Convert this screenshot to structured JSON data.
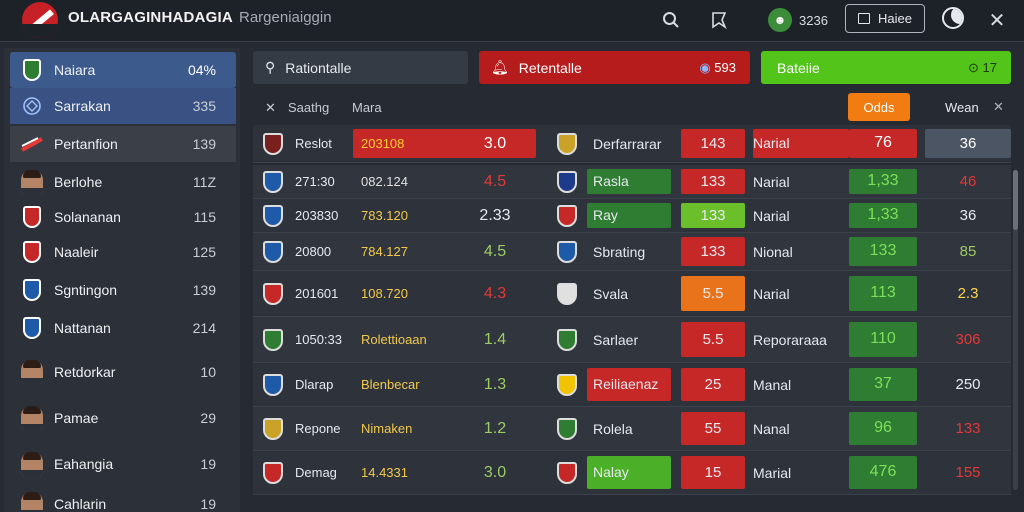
{
  "header": {
    "app_title": "OLARGAGINHADAGIA",
    "subtitle": "Rargeniaiggin",
    "user_count": "3236",
    "home_label": "Haiee"
  },
  "sidebar": {
    "items": [
      {
        "label": "Naiara",
        "value": "04%",
        "icon": "team-crest-icon",
        "color": "#2e7d32"
      },
      {
        "label": "Sarrakan",
        "value": "335",
        "icon": "globe-icon",
        "color": "#3f6fb5"
      },
      {
        "label": "Pertanfion",
        "value": "139",
        "icon": "flag-icon",
        "color": "#c62828"
      },
      {
        "label": "Berlohe",
        "value": "11Z",
        "icon": "player-avatar-icon",
        "color": "#b48466"
      },
      {
        "label": "Solananan",
        "value": "115",
        "icon": "team-crest-icon",
        "color": "#c62828"
      },
      {
        "label": "Naaleir",
        "value": "125",
        "icon": "team-crest-icon",
        "color": "#c62828"
      },
      {
        "label": "Sgntingon",
        "value": "139",
        "icon": "team-crest-icon",
        "color": "#1e5aa8"
      },
      {
        "label": "Nattanan",
        "value": "214",
        "icon": "team-crest-icon",
        "color": "#1e5aa8"
      },
      {
        "label": "Retdorkar",
        "value": "10",
        "icon": "player-avatar-icon",
        "color": "#b48466"
      },
      {
        "label": "Pamae",
        "value": "29",
        "icon": "player-avatar-icon",
        "color": "#b48466"
      },
      {
        "label": "Eahangia",
        "value": "19",
        "icon": "player-avatar-icon",
        "color": "#b48466"
      },
      {
        "label": "Cahlarin",
        "value": "19",
        "icon": "player-avatar-icon",
        "color": "#b48466"
      }
    ]
  },
  "filters": {
    "search": {
      "label": "Rationtalle"
    },
    "alert": {
      "label": "Retentalle",
      "value": "593",
      "color": "#b71c1c"
    },
    "green": {
      "label": "Bateiie",
      "value": "17",
      "color": "#52c41a"
    }
  },
  "subheader": {
    "col1": "Saathg",
    "col2": "Mara",
    "odds": "Odds",
    "wean": "Wean"
  },
  "rows": [
    {
      "time": "Reslot",
      "odds1": "203108",
      "val1": "3.0",
      "team2": "Derfarrarar",
      "s1": "143",
      "mkt": "Narial",
      "s2": "76",
      "s3": "36",
      "c_odds1": "#c62828",
      "c_val1": "#c62828",
      "c_s1": "#c62828",
      "c_mkt": "#c62828",
      "c_s2": "#c62828",
      "c_s3": "#4b5563",
      "header": true
    },
    {
      "time": "271:30",
      "odds1": "082.124",
      "val1": "4.5",
      "team2": "Rasla",
      "s1": "133",
      "mkt": "Narial",
      "s2": "1,33",
      "s3": "46",
      "c_team2": "#2e7d32",
      "c_s1": "#c62828",
      "c_s2": "#2e7d32",
      "t_val1": "#e53935",
      "t_s3": "#e53935",
      "t_odds1": "#e0e0e0"
    },
    {
      "time": "203830",
      "odds1": "783.120",
      "val1": "2.33",
      "team2": "Ray",
      "s1": "133",
      "mkt": "Narial",
      "s2": "1,33",
      "s3": "36",
      "c_team2": "#2e7d32",
      "c_s1": "#6abf2b",
      "c_s2": "#2e7d32"
    },
    {
      "time": "20800",
      "odds1": "784.127",
      "val1": "4.5",
      "team2": "Sbrating",
      "s1": "133",
      "mkt": "Nional",
      "s2": "133",
      "s3": "85",
      "c_s1": "#c62828",
      "c_s2": "#2e7d32",
      "t_val1": "#9ccc65",
      "t_s3": "#9ccc65"
    },
    {
      "time": "201601",
      "odds1": "108.720",
      "val1": "4.3",
      "team2": "Svala",
      "s1": "5.5",
      "mkt": "Narial",
      "s2": "113",
      "s3": "2.3",
      "c_s1": "#e8731a",
      "c_s2": "#2e7d32",
      "t_val1": "#e53935",
      "t_s3": "#ffd54f"
    },
    {
      "time": "1050:33",
      "odds1": "Rolettioaan",
      "val1": "1.4",
      "team2": "Sarlaer",
      "s1": "5.5",
      "mkt": "Reporaraaa",
      "s2": "110",
      "s3": "306",
      "c_s1": "#c62828",
      "c_s2": "#2e7d32",
      "t_val1": "#9ccc65",
      "t_s3": "#e53935"
    },
    {
      "time": "Dlarap",
      "odds1": "Blenbecar",
      "val1": "1.3",
      "team2": "Reiliaenaz",
      "s1": "25",
      "mkt": "Manal",
      "s2": "37",
      "s3": "250",
      "c_team2": "#c62828",
      "c_s1": "#c62828",
      "c_s2": "#2e7d32",
      "t_val1": "#9ccc65",
      "t_s3": "#e6e9ee"
    },
    {
      "time": "Repone",
      "odds1": "Nimaken",
      "val1": "1.2",
      "team2": "Rolela",
      "s1": "55",
      "mkt": "Nanal",
      "s2": "96",
      "s3": "133",
      "c_s1": "#c62828",
      "c_s2": "#2e7d32",
      "t_val1": "#9ccc65",
      "t_s3": "#e53935"
    },
    {
      "time": "Demag",
      "odds1": "14.4331",
      "val1": "3.0",
      "team2": "Nalay",
      "s1": "15",
      "mkt": "Marial",
      "s2": "476",
      "s3": "155",
      "c_team2": "#4caf28",
      "c_s1": "#c62828",
      "c_s2": "#2e7d32",
      "t_val1": "#9ccc65",
      "t_s3": "#e53935"
    }
  ]
}
